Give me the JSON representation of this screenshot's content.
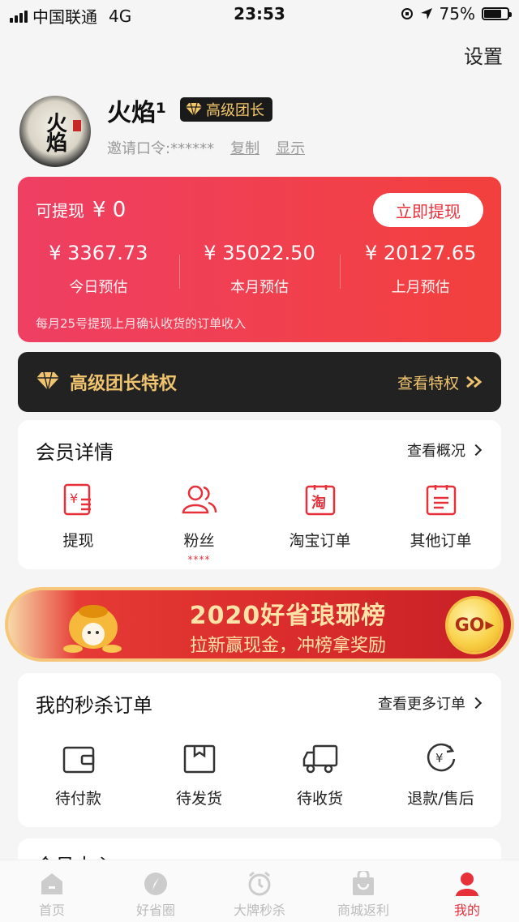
{
  "status_bar": {
    "carrier": "中国联通",
    "network": "4G",
    "time": "23:53",
    "battery": "75%",
    "battery_level": 0.75
  },
  "header": {
    "settings_label": "设置"
  },
  "profile": {
    "avatar_text": "火焰",
    "name": "火焰¹",
    "badge_label": "高级团长",
    "invite_label": "邀请口令:******",
    "copy_label": "复制",
    "show_label": "显示"
  },
  "balance": {
    "withdrawable_label": "可提现",
    "withdrawable_amount": "¥ 0",
    "withdraw_button": "立即提现",
    "stats": [
      {
        "value": "¥ 3367.73",
        "label": "今日预估"
      },
      {
        "value": "¥ 35022.50",
        "label": "本月预估"
      },
      {
        "value": "¥ 20127.65",
        "label": "上月预估"
      }
    ],
    "note": "每月25号提现上月确认收货的订单收入"
  },
  "privilege": {
    "title": "高级团长特权",
    "link": "查看特权"
  },
  "member": {
    "title": "会员详情",
    "more": "查看概况",
    "items": [
      {
        "label": "提现",
        "icon": "withdraw-icon"
      },
      {
        "label": "粉丝",
        "icon": "fans-icon",
        "sub": "****"
      },
      {
        "label": "淘宝订单",
        "icon": "taobao-order-icon"
      },
      {
        "label": "其他订单",
        "icon": "other-order-icon"
      }
    ]
  },
  "banner": {
    "title": "2020好省琅琊榜",
    "subtitle": "拉新赢现金，冲榜拿奖励",
    "go": "GO"
  },
  "flash_orders": {
    "title": "我的秒杀订单",
    "more": "查看更多订单",
    "items": [
      {
        "label": "待付款",
        "icon": "wallet-icon"
      },
      {
        "label": "待发货",
        "icon": "box-icon"
      },
      {
        "label": "待收货",
        "icon": "truck-icon"
      },
      {
        "label": "退款/售后",
        "icon": "refund-icon"
      }
    ]
  },
  "member_center": {
    "title": "会员中心"
  },
  "tabs": [
    {
      "label": "首页",
      "icon": "home-icon"
    },
    {
      "label": "好省圈",
      "icon": "compass-icon"
    },
    {
      "label": "大牌秒杀",
      "icon": "alarm-icon"
    },
    {
      "label": "商城返利",
      "icon": "shopping-bag-icon"
    },
    {
      "label": "我的",
      "icon": "user-icon",
      "active": true
    }
  ],
  "colors": {
    "accent": "#e8303a",
    "gold": "#f0c46f",
    "dark": "#222222"
  }
}
